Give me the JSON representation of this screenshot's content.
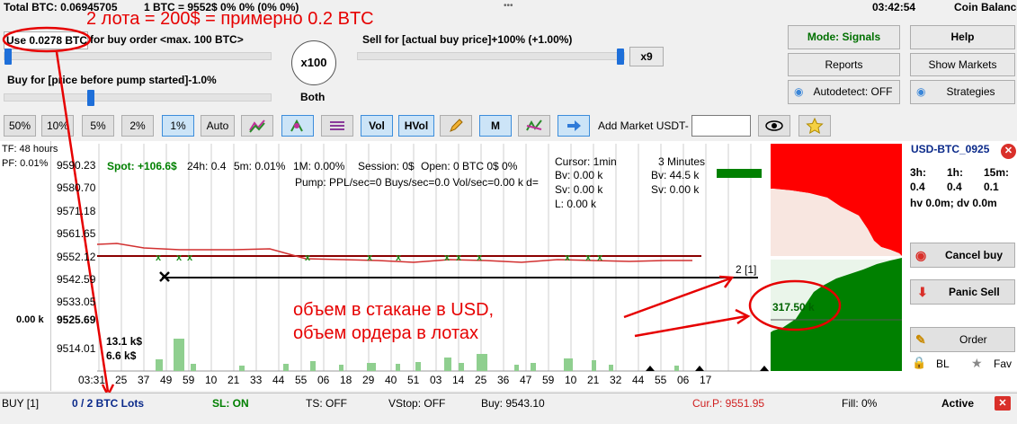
{
  "topbar": {
    "total_btc": "Total BTC: 0.06945705",
    "btc_price": "1 BTC = 9552$  0% 0% (0% 0%)",
    "dots": "•••",
    "time": "03:42:54",
    "coin_balance": "Coin Balance"
  },
  "controls": {
    "use_btc": "Use 0.0278 BTC",
    "buy_order_max": "for buy order <max. 100 BTC>",
    "buy_for": "Buy for [price before pump started]-1.0%",
    "sell_for": "Sell for [actual buy price]+100% (+1.00%)",
    "x100": "x100",
    "both": "Both",
    "x9": "x9"
  },
  "right_panel": {
    "mode": "Mode: Signals",
    "help": "Help",
    "reports": "Reports",
    "show_markets": "Show Markets",
    "autodetect": "Autodetect: OFF",
    "strategies": "Strategies"
  },
  "toolbar": {
    "p50": "50%",
    "p10": "10%",
    "p5": "5%",
    "p2": "2%",
    "p1": "1%",
    "auto": "Auto",
    "vol": "Vol",
    "hvol": "HVol",
    "m": "M",
    "add_market": "Add Market USDT-"
  },
  "chart": {
    "tf": "TF: 48 hours",
    "pf": "PF: 0.01%",
    "left_vol": "0.00 k",
    "y_ticks": [
      "9590.23",
      "9580.70",
      "9571.18",
      "9561.65",
      "9552.12",
      "9542.59",
      "9533.05",
      "9525.69",
      "9514.01"
    ],
    "x_ticks": [
      "03:31",
      "25",
      "37",
      "49",
      "59",
      "10",
      "21",
      "33",
      "44",
      "55",
      "06",
      "18",
      "29",
      "40",
      "51",
      "03",
      "14",
      "25",
      "36",
      "47",
      "59",
      "10",
      "21",
      "32",
      "44",
      "55",
      "06",
      "17"
    ],
    "spot": "Spot: +106.6$",
    "h24": "24h: 0.4",
    "m5": "5m: 0.01%",
    "m1": "1M: 0.00%",
    "session": "Session: 0$",
    "open": "Open: 0 BTC  0$  0%",
    "pump": "Pump: PPL/sec=0 Buys/sec=0.0  Vol/sec=0.00 k  d=",
    "cursor": "Cursor: 1min",
    "bv1": "Bv: 0.00 k",
    "sv1": "Sv: 0.00 k",
    "l1": "L: 0.00 k",
    "three_min": "3 Minutes",
    "bv2": "Bv: 44.5 k",
    "sv2": "Sv: 0.00 k",
    "vol1": "13.1 k$",
    "vol2": "6.6 k$",
    "order_count": "2  [1]",
    "book_volume": "317.50 k"
  },
  "market_panel": {
    "pair": "USD-BTC_0925",
    "h3": "3h:",
    "h1": "1h:",
    "m15": "15m:",
    "v3": "0.4",
    "v1": "0.4",
    "v15": "0.1",
    "hv": "hv 0.0m; dv 0.0m",
    "cancel_buy": "Cancel buy",
    "panic_sell": "Panic Sell",
    "order": "Order",
    "bl": "BL",
    "fav": "Fav"
  },
  "status": {
    "buy": "BUY [1]",
    "lots": "0 / 2 BTC Lots",
    "sl": "SL: ON",
    "ts": "TS: OFF",
    "vstop": "VStop: OFF",
    "buy_price": "Buy: 9543.10",
    "cur": "Cur.P: 9551.95",
    "fill": "Fill: 0%",
    "active": "Active"
  },
  "annotations": {
    "lots": "2 лота = 200$ = примерно 0.2 BTC",
    "volume1": "объем в стакане в USD,",
    "volume2": "объем ордера в лотах"
  },
  "colors": {
    "accent": "#1e6fd9",
    "buy_green": "#008000",
    "sell_red": "#e00000",
    "annotation": "#e60000"
  }
}
